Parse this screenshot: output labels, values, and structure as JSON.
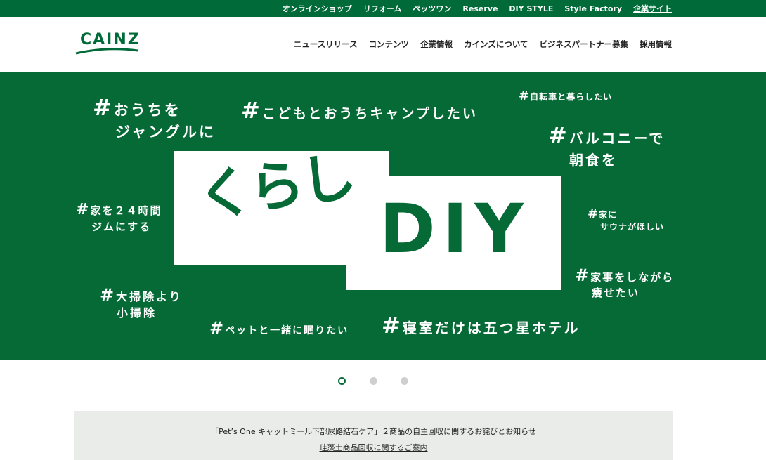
{
  "topbar": {
    "links": [
      "オンラインショップ",
      "リフォーム",
      "ペッツワン",
      "Reserve",
      "DIY STYLE",
      "Style Factory",
      "企業サイト"
    ]
  },
  "header": {
    "logo_text": "CAINZ",
    "nav": [
      "ニュースリリース",
      "コンテンツ",
      "企業情報",
      "カインズについて",
      "ビジネスパートナー募集",
      "採用情報"
    ]
  },
  "hero": {
    "title_kurashi": "くらし",
    "title_diy": "DIY",
    "hash": "#",
    "tags": {
      "t1a": "おうちを",
      "t1b": "ジャングルに",
      "t2": "こどもとおうちキャンプしたい",
      "t3": "自転車と暮らしたい",
      "t4a": "バルコニーで",
      "t4b": "朝食を",
      "t5a": "家を２４時間",
      "t5b": "ジムにする",
      "t6a": "家に",
      "t6b": "サウナがほしい",
      "t7a": "家事をしながら",
      "t7b": "痩せたい",
      "t8a": "大掃除より",
      "t8b": "小掃除",
      "t9": "ペットと一緒に眠りたい",
      "t10": "寝室だけは五つ星ホテル"
    }
  },
  "carousel": {
    "count": 3,
    "active": 1
  },
  "notices": [
    "「Pet’s One キャットミール下部尿路結石ケア」２商品の自主回収に関するお詫びとお知らせ",
    "珪藻土商品回収に関するご案内"
  ],
  "colors": {
    "brand_green": "#006a38",
    "hero_green": "#066a36"
  }
}
